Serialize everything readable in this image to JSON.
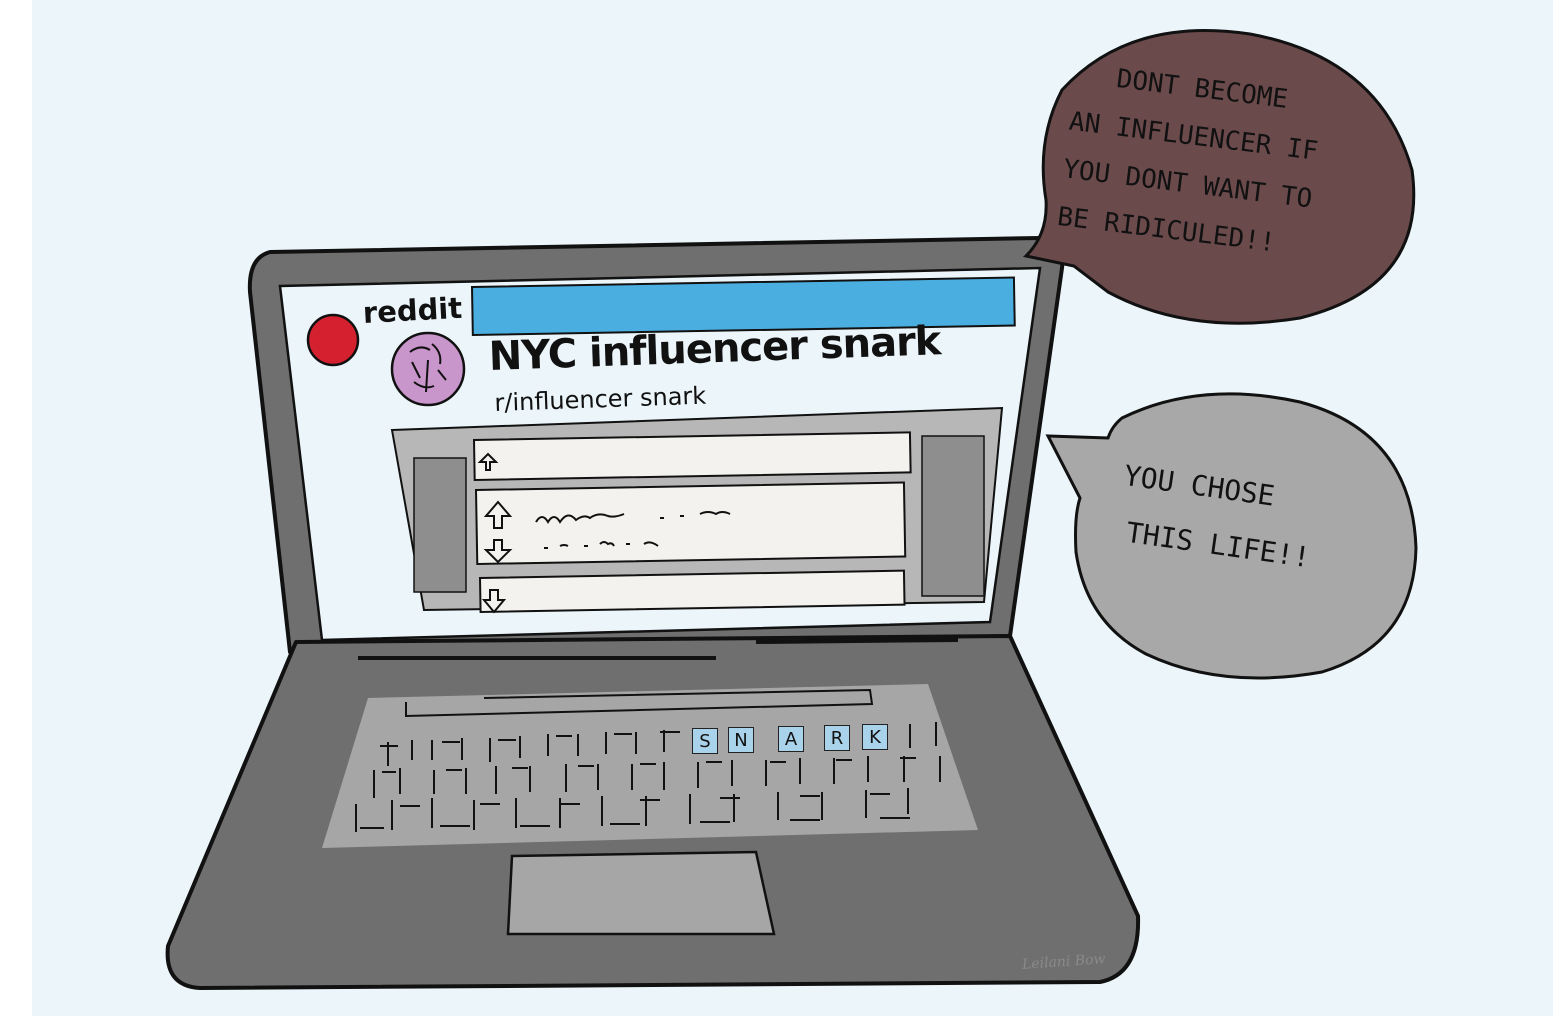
{
  "page": {
    "background": "#ecf6fa"
  },
  "browser": {
    "brand": "reddit",
    "brand_logo_color": "#d4202f",
    "search_bar_color": "#4baee0"
  },
  "subreddit": {
    "title": "NYC influencer snark",
    "handle": "r/influencer snark",
    "avatar_color": "#c996cc"
  },
  "keyboard": {
    "highlight_color": "#a9d3ea",
    "highlighted_keys": [
      "S",
      "N",
      "A",
      "R",
      "K"
    ]
  },
  "bubbles": {
    "dark": {
      "color": "#6b4a4c",
      "lines": [
        "Dont become",
        "an influencer if",
        "you dont want to",
        "be ridiculed!!"
      ]
    },
    "gray": {
      "color": "#a8a8a8",
      "lines": [
        "you chose",
        "this life!!"
      ]
    }
  },
  "signature": "Leilani Bow"
}
